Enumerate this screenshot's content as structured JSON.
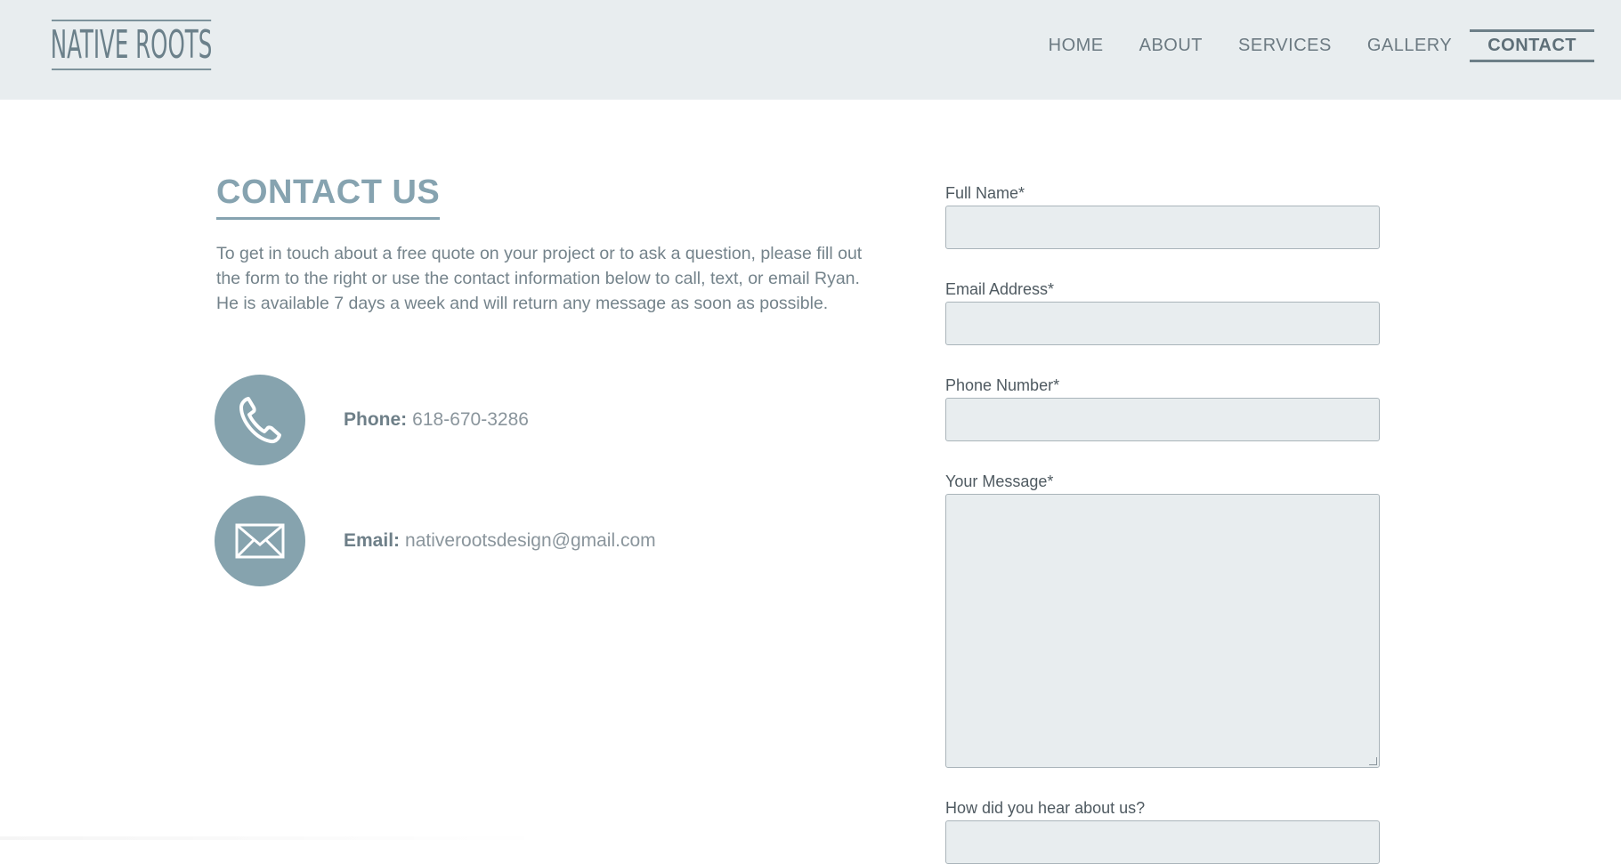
{
  "header": {
    "logo": "NATIVE ROOTS",
    "nav": [
      "HOME",
      "ABOUT",
      "SERVICES",
      "GALLERY",
      "CONTACT"
    ],
    "active": "CONTACT"
  },
  "main": {
    "title": "CONTACT US",
    "intro": "To get in touch about a free quote on your project or to ask a question, please fill out the form to the right or use the contact information below to call, text, or email Ryan. He is available 7 days a week and will return any message as soon as possible.",
    "phone": {
      "label": "Phone:",
      "value": "618-670-3286",
      "icon": "phone-icon"
    },
    "email": {
      "label": "Email:",
      "value": "nativerootsdesign@gmail.com",
      "icon": "envelope-icon"
    }
  },
  "form": {
    "full_name_label": "Full Name*",
    "email_label": "Email Address*",
    "phone_label": "Phone Number*",
    "message_label": "Your Message*",
    "heard_label": "How did you hear about us?"
  },
  "colors": {
    "header_bg": "#e8edef",
    "accent": "#86a3ae",
    "field_bg": "#e8edef"
  }
}
